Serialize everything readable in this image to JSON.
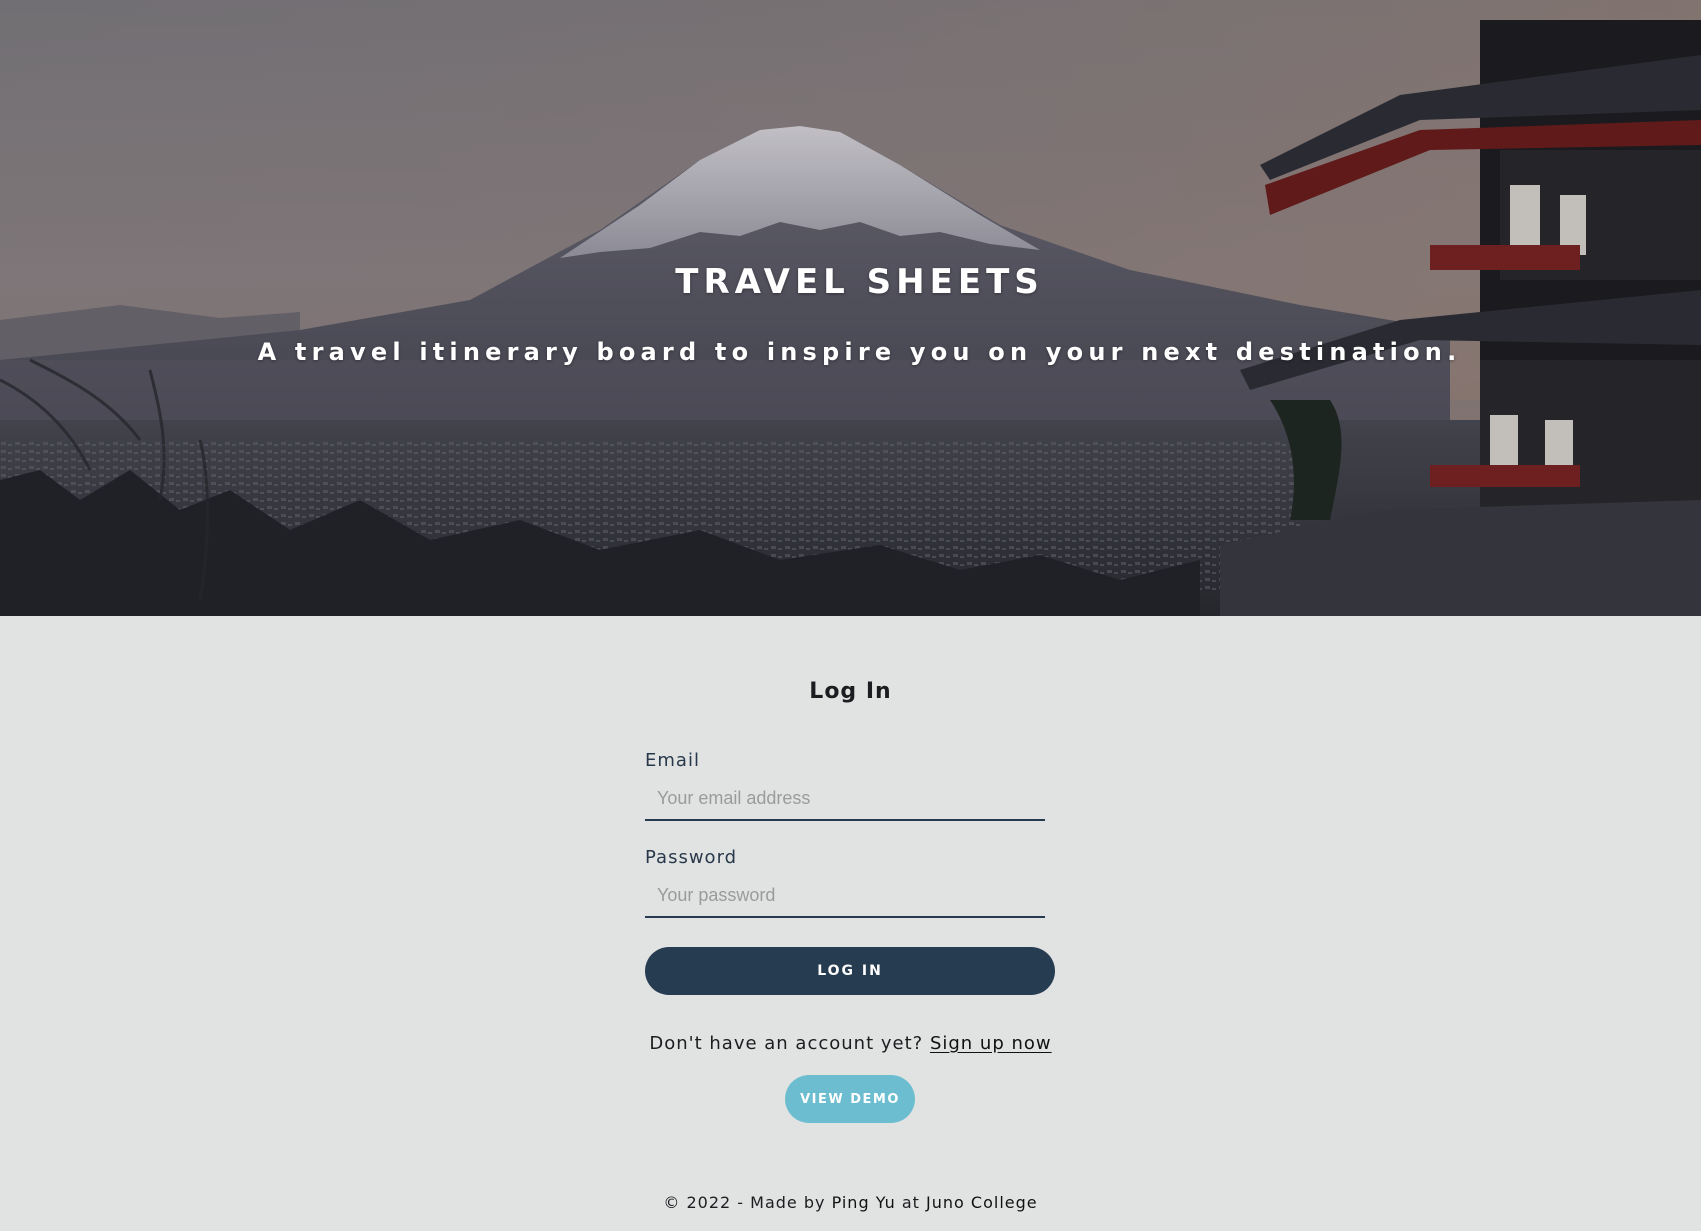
{
  "hero": {
    "title": "TRAVEL SHEETS",
    "subtitle": "A travel itinerary board to inspire you on your next destination."
  },
  "login": {
    "heading": "Log In",
    "email_label": "Email",
    "email_placeholder": "Your email address",
    "email_value": "",
    "password_label": "Password",
    "password_placeholder": "Your password",
    "password_value": "",
    "submit_label": "LOG IN",
    "signup_prompt": "Don't have an account yet?",
    "signup_link": "Sign up now",
    "demo_label": "VIEW DEMO"
  },
  "footer": {
    "prefix": "© 2022 - Made by",
    "author": "Ping Yu",
    "joiner": "at",
    "school": "Juno College"
  },
  "colors": {
    "page_background": "#e1e3e2",
    "primary_button": "#263c51",
    "demo_button": "#6dbdd0",
    "input_underline": "#263b50",
    "text": "#1b1d20"
  }
}
